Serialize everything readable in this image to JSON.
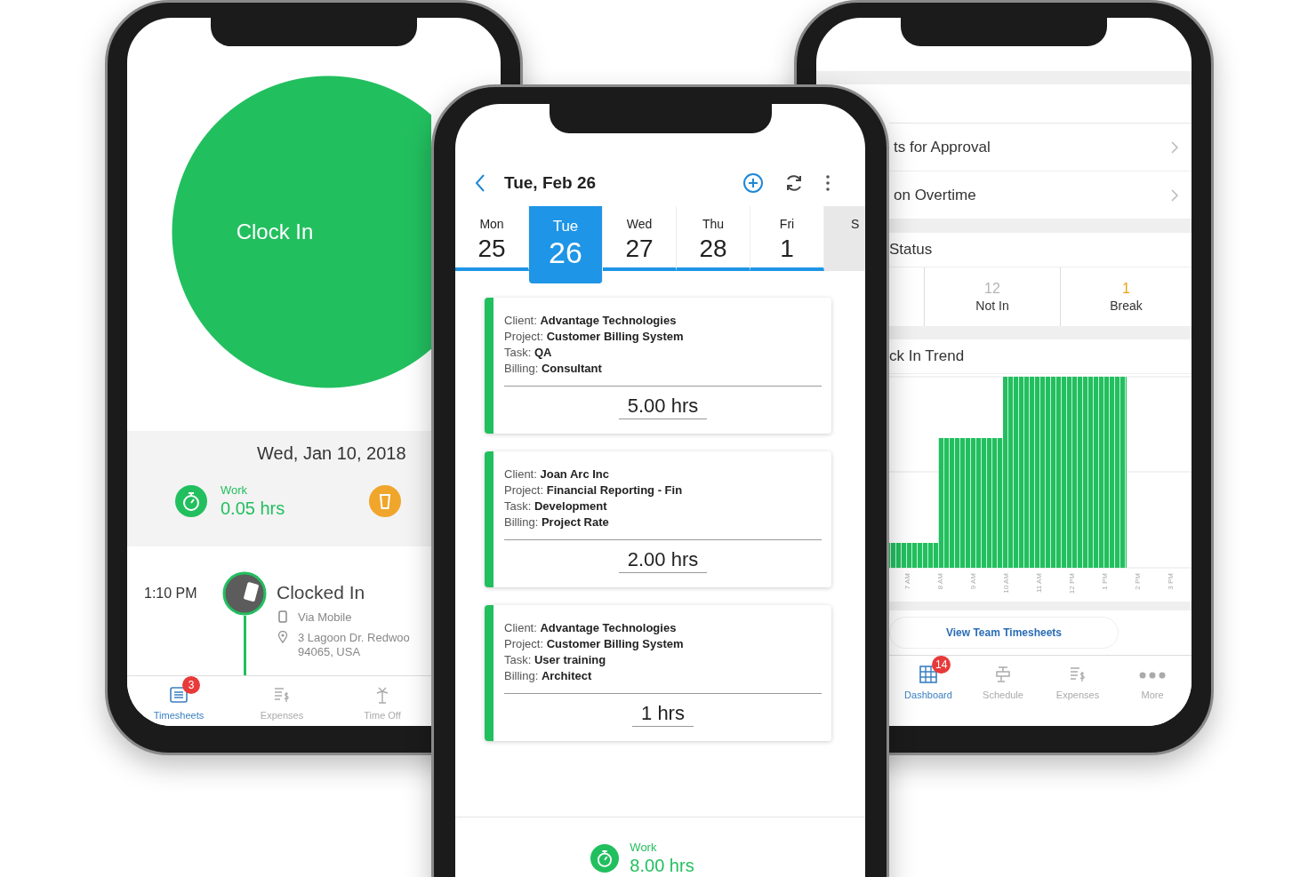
{
  "left_phone": {
    "clock_button": "Clock In",
    "date": "Wed, Jan 10, 2018",
    "summary": {
      "label": "Work",
      "value": "0.05 hrs"
    },
    "timeline": [
      {
        "time": "1:10 PM",
        "title": "Clocked In",
        "via": "Via Mobile",
        "address": [
          "3 Lagoon Dr. Redwoo",
          "94065, USA"
        ]
      }
    ],
    "tab_bar": [
      {
        "label": "Timesheets",
        "selected": true,
        "badge": "3",
        "kind": "list"
      },
      {
        "label": "Expenses",
        "selected": false,
        "kind": "receipt"
      },
      {
        "label": "Time Off",
        "selected": false,
        "kind": "tree"
      }
    ]
  },
  "middle_phone": {
    "title": "Tue, Feb 26",
    "days": [
      {
        "day": "Mon",
        "date": "25",
        "selected": false,
        "weekend": false
      },
      {
        "day": "Tue",
        "date": "26",
        "selected": true,
        "weekend": false
      },
      {
        "day": "Wed",
        "date": "27",
        "selected": false,
        "weekend": false
      },
      {
        "day": "Thu",
        "date": "28",
        "selected": false,
        "weekend": false
      },
      {
        "day": "Fri",
        "date": "1",
        "selected": false,
        "weekend": false
      },
      {
        "day": "S",
        "selected": false,
        "weekend": true
      }
    ],
    "entries": [
      {
        "lines": [
          "Client: **Advantage Technologies**",
          "Project: **Customer Billing System**",
          "Task: **QA**",
          "Billing: **Consultant**"
        ],
        "hours": "5.00 hrs"
      },
      {
        "lines": [
          "Client: **Joan Arc Inc**",
          "Project: **Financial Reporting - Fin**",
          "Task: **Development**",
          "Billing: **Project Rate**"
        ],
        "hours": "2.00 hrs"
      },
      {
        "lines": [
          "Client: **Advantage Technologies**",
          "Project: **Customer Billing System**",
          "Task: **User training**",
          "Billing: **Architect**"
        ],
        "hours": "1 hrs"
      }
    ],
    "footer": {
      "label": "Work",
      "value": "8.00 hrs"
    }
  },
  "right_phone": {
    "menu_rows": [
      {
        "label": "ts for Approval"
      },
      {
        "label": "on Overtime"
      }
    ],
    "status_title": "Status",
    "status_cells": [
      {
        "count": "12",
        "label": "Not In",
        "color": "#b5b5b5"
      },
      {
        "count": "1",
        "label": "Break",
        "color": "#e8a317"
      }
    ],
    "chart_title": "ck In Trend",
    "x_labels": [
      "7 AM",
      "8 AM",
      "9 AM",
      "10 AM",
      "11 AM",
      "12 PM",
      "1 PM",
      "2 PM",
      "3 PM"
    ],
    "button": "View Team Timesheets",
    "tab_bar": [
      {
        "label": "Dashboard",
        "selected": true,
        "badge": "14",
        "kind": "grid"
      },
      {
        "label": "Schedule",
        "selected": false,
        "kind": "schedule"
      },
      {
        "label": "Expenses",
        "selected": false,
        "kind": "receipt"
      },
      {
        "label": "More",
        "selected": false,
        "kind": "dots"
      }
    ]
  }
}
